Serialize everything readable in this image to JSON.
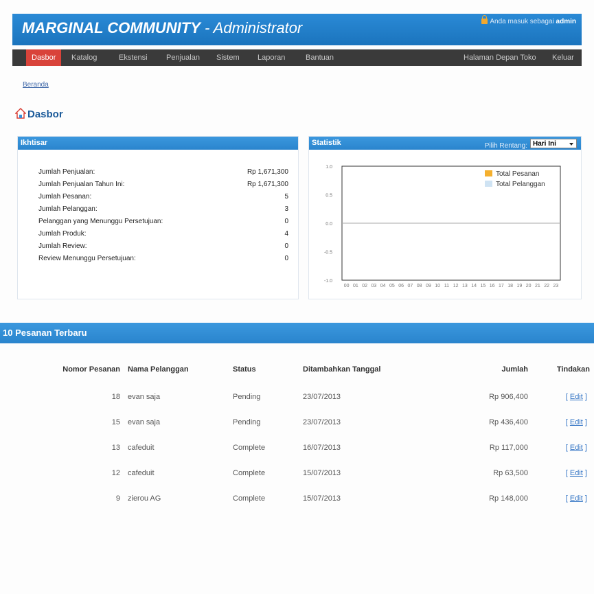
{
  "header": {
    "brand": "MARGINAL COMMUNITY",
    "suffix": " - Administrator",
    "login_text": "Anda masuk sebagai ",
    "login_user": "admin"
  },
  "menu": {
    "left": [
      "Dasbor",
      "Katalog",
      "Ekstensi",
      "Penjualan",
      "Sistem",
      "Laporan",
      "Bantuan"
    ],
    "right": [
      "Halaman Depan Toko",
      "Keluar"
    ]
  },
  "breadcrumb": "Beranda",
  "page_title": "Dasbor",
  "summary": {
    "title": "Ikhtisar",
    "rows": [
      {
        "label": "Jumlah Penjualan:",
        "value": "Rp 1,671,300"
      },
      {
        "label": "Jumlah Penjualan Tahun Ini:",
        "value": "Rp 1,671,300"
      },
      {
        "label": "Jumlah Pesanan:",
        "value": "5"
      },
      {
        "label": "Jumlah Pelanggan:",
        "value": "3"
      },
      {
        "label": "Pelanggan yang Menunggu Persetujuan:",
        "value": "0"
      },
      {
        "label": "Jumlah Produk:",
        "value": "4"
      },
      {
        "label": "Jumlah Review:",
        "value": "0"
      },
      {
        "label": "Review Menunggu Persetujuan:",
        "value": "0"
      }
    ]
  },
  "statistics": {
    "title": "Statistik",
    "range_label": "Pilih Rentang:",
    "range_value": "Hari Ini"
  },
  "chart_data": {
    "type": "bar",
    "categories": [
      "00",
      "01",
      "02",
      "03",
      "04",
      "05",
      "06",
      "07",
      "08",
      "09",
      "10",
      "11",
      "12",
      "13",
      "14",
      "15",
      "16",
      "17",
      "18",
      "19",
      "20",
      "21",
      "22",
      "23"
    ],
    "series": [
      {
        "name": "Total Pesanan",
        "color": "#f5b02e",
        "values": [
          0,
          0,
          0,
          0,
          0,
          0,
          0,
          0,
          0,
          0,
          0,
          0,
          0,
          0,
          0,
          0,
          0,
          0,
          0,
          0,
          0,
          0,
          0,
          0
        ]
      },
      {
        "name": "Total Pelanggan",
        "color": "#cfe3f3",
        "values": [
          0,
          0,
          0,
          0,
          0,
          0,
          0,
          0,
          0,
          0,
          0,
          0,
          0,
          0,
          0,
          0,
          0,
          0,
          0,
          0,
          0,
          0,
          0,
          0
        ]
      }
    ],
    "yticks": [
      "1.0",
      "0.5",
      "0.0",
      "-0.5",
      "-1.0"
    ],
    "ylim": [
      -1,
      1
    ],
    "legend": "top-right",
    "title": "",
    "xlabel": "",
    "ylabel": ""
  },
  "orders": {
    "title": "10 Pesanan Terbaru",
    "columns": [
      "Nomor Pesanan",
      "Nama Pelanggan",
      "Status",
      "Ditambahkan Tanggal",
      "Jumlah",
      "Tindakan"
    ],
    "rows": [
      {
        "id": "18",
        "name": "evan saja",
        "status": "Pending",
        "date": "23/07/2013",
        "total": "Rp 906,400",
        "action": "Edit"
      },
      {
        "id": "15",
        "name": "evan saja",
        "status": "Pending",
        "date": "23/07/2013",
        "total": "Rp 436,400",
        "action": "Edit"
      },
      {
        "id": "13",
        "name": "cafeduit",
        "status": "Complete",
        "date": "16/07/2013",
        "total": "Rp 117,000",
        "action": "Edit"
      },
      {
        "id": "12",
        "name": "cafeduit",
        "status": "Complete",
        "date": "15/07/2013",
        "total": "Rp 63,500",
        "action": "Edit"
      },
      {
        "id": "9",
        "name": "zierou AG",
        "status": "Complete",
        "date": "15/07/2013",
        "total": "Rp 148,000",
        "action": "Edit"
      }
    ]
  }
}
